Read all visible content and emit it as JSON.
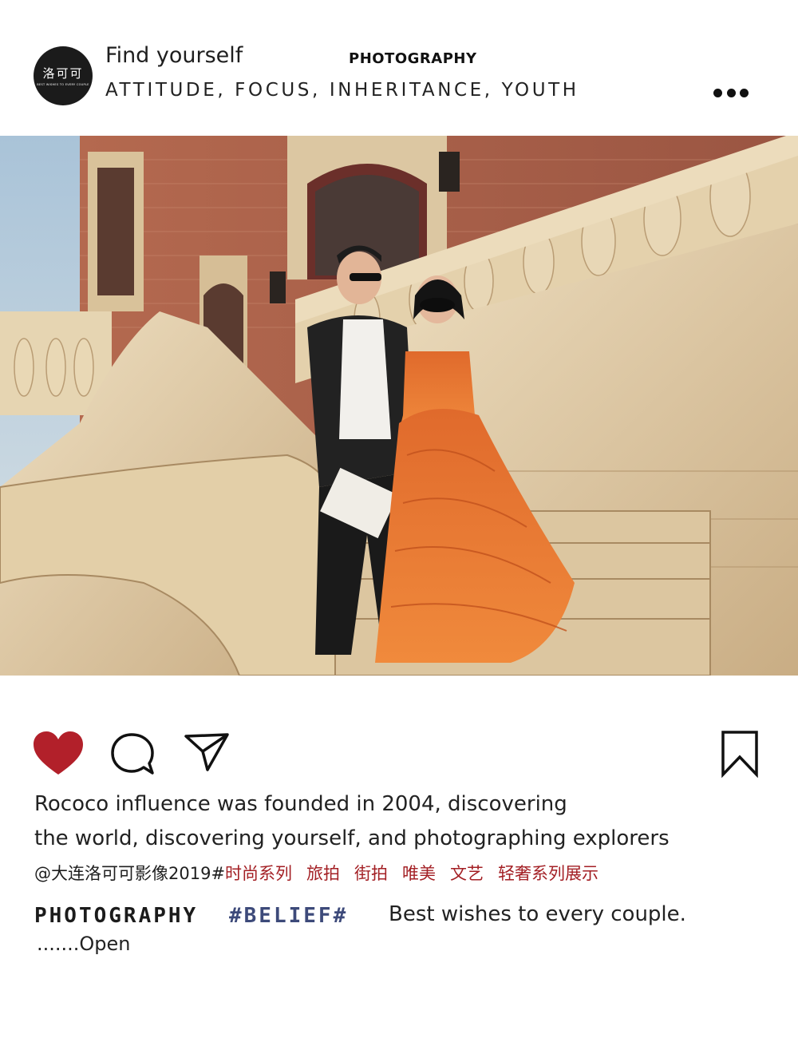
{
  "header": {
    "avatar_title": "洛可可",
    "avatar_subtitle": "BEST WISHES TO EVERY COUPLE",
    "find_text": "Find yourself",
    "brand_text": "PHOTOGRAPHY",
    "tagline": "ATTITUDE, FOCUS, INHERITANCE, YOUTH",
    "more_icon": "more-horizontal-icon"
  },
  "post": {
    "image_subject": "couple-on-stone-staircase"
  },
  "actions": {
    "like_icon": "heart-icon",
    "like_color": "#b2202a",
    "comment_icon": "comment-bubble-icon",
    "share_icon": "paper-plane-icon",
    "save_icon": "bookmark-icon"
  },
  "caption": {
    "line1": "Rococo influence was founded in 2004, discovering",
    "line2": "the world, discovering yourself, and photographing explorers"
  },
  "tags": {
    "handle": "@大连洛可可影像2019#",
    "items": [
      "时尚系列",
      "旅拍",
      "街拍",
      "唯美",
      "文艺",
      "轻奢系列展示"
    ],
    "tag_color": "#a31f24"
  },
  "footer": {
    "photography": "PHOTOGRAPHY",
    "belief": "#BELIEF#",
    "belief_color": "#3d4a7a",
    "wishes": "Best wishes to every couple.",
    "open": ".......Open"
  }
}
